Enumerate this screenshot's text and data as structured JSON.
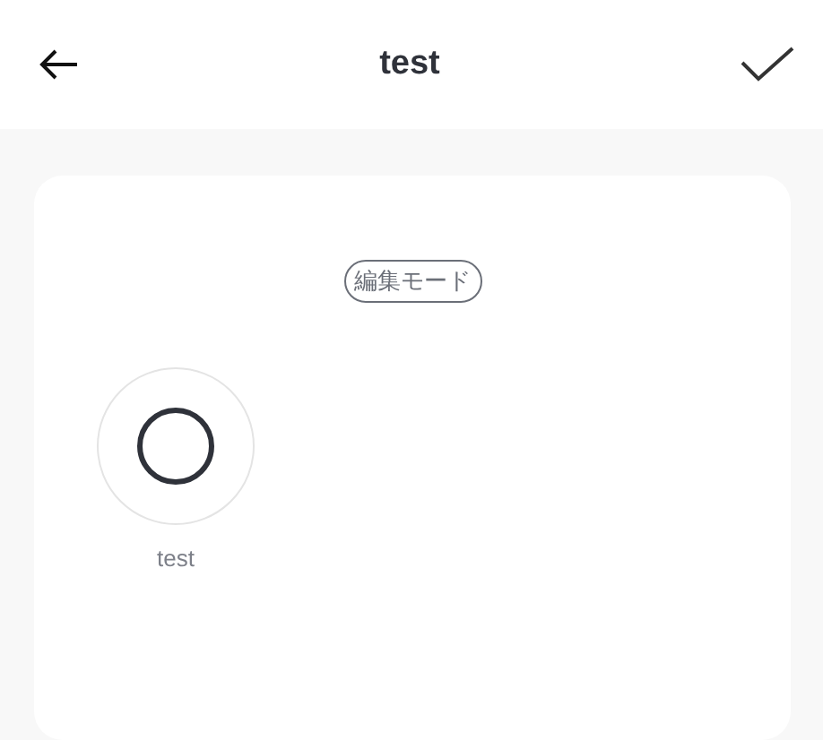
{
  "header": {
    "title": "test"
  },
  "mode_badge": "編集モード",
  "items": [
    {
      "label": "test"
    }
  ]
}
